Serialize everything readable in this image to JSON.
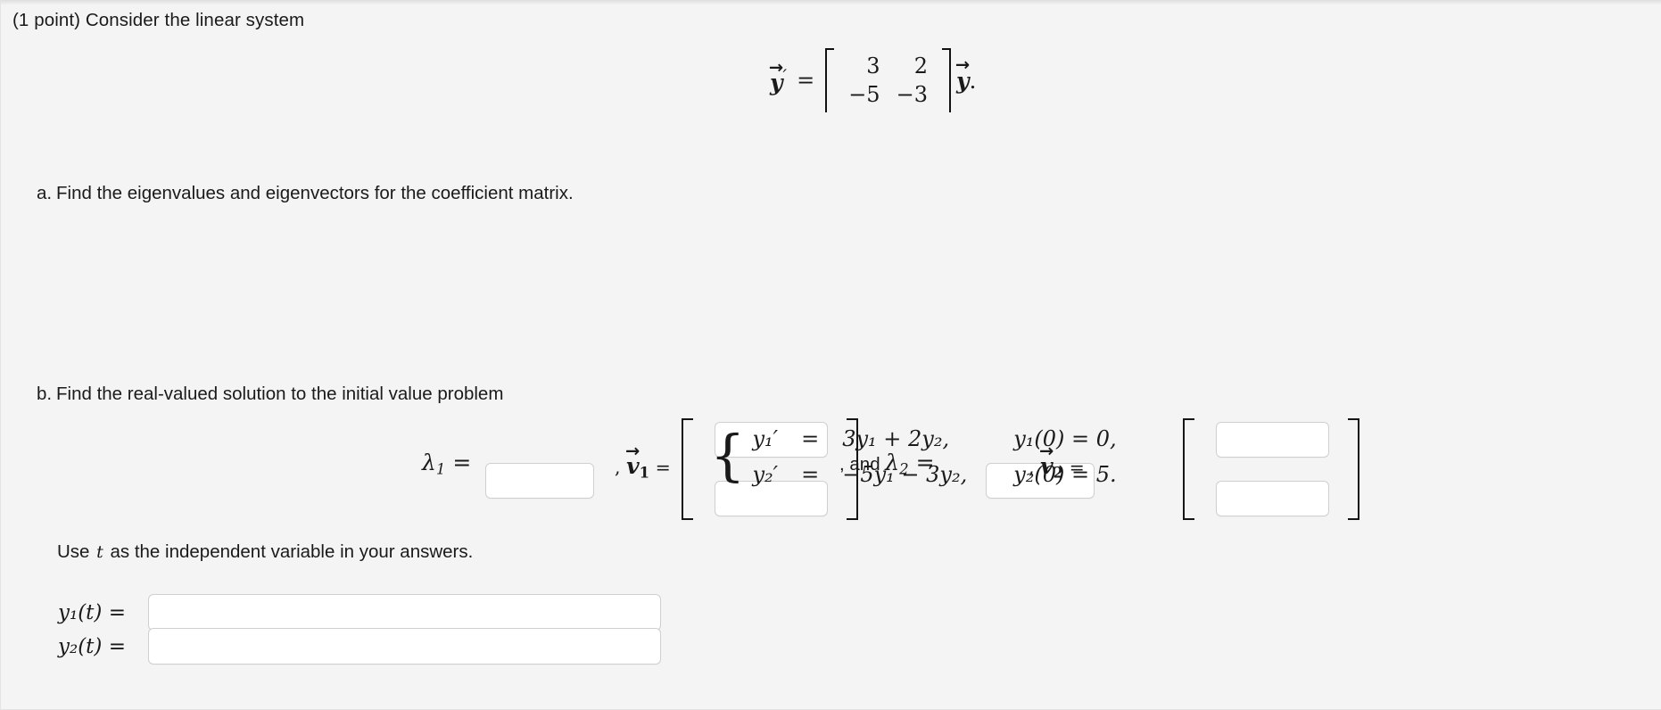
{
  "problem": {
    "points_label": "(1 point) Consider the linear system",
    "system_equation": {
      "lhs_vector": "y",
      "lhs_prime": "′",
      "equals": "=",
      "matrix": [
        [
          "3",
          "2"
        ],
        [
          "−5",
          "−3"
        ]
      ],
      "rhs_vector": "y",
      "trailing_punctuation": "."
    }
  },
  "part_a": {
    "letter": "a.",
    "text": "Find the eigenvalues and eigenvectors for the coefficient matrix.",
    "lambda1_label": "λ",
    "lambda1_sub": "1",
    "lambda2_prefix": ", and ",
    "lambda2_label": "λ",
    "lambda2_sub": "2",
    "equals": "=",
    "comma": ",",
    "v1_label": "v",
    "v1_sub": "1",
    "v2_label": "v",
    "v2_sub": "2",
    "vector_arrow": "→",
    "inputs": {
      "lambda1": "",
      "lambda2": "",
      "v1_top": "",
      "v1_bottom": "",
      "v2_top": "",
      "v2_bottom": ""
    }
  },
  "part_b": {
    "letter": "b.",
    "text": "Find the real-valued solution to the initial value problem",
    "system": {
      "rows": [
        {
          "lhs": "y₁′",
          "equals": "=",
          "rhs": "3y₁ + 2y₂,",
          "initial_condition": "y₁(0) = 0,"
        },
        {
          "lhs": "y₂′",
          "equals": "=",
          "rhs": "−5y₁ − 3y₂,",
          "initial_condition": "y₂(0) = 5."
        }
      ]
    },
    "instruction_prefix": "Use ",
    "instruction_variable": "t",
    "instruction_suffix": " as the independent variable in your answers.",
    "solution_labels": {
      "y1": "y₁(t) =",
      "y2": "y₂(t) ="
    },
    "inputs": {
      "y1": "",
      "y2": ""
    }
  },
  "style": {
    "background": "#f4f4f4",
    "text_color": "#1a1a1a",
    "input_background": "#ffffff",
    "input_border": "#cfcfcf"
  }
}
